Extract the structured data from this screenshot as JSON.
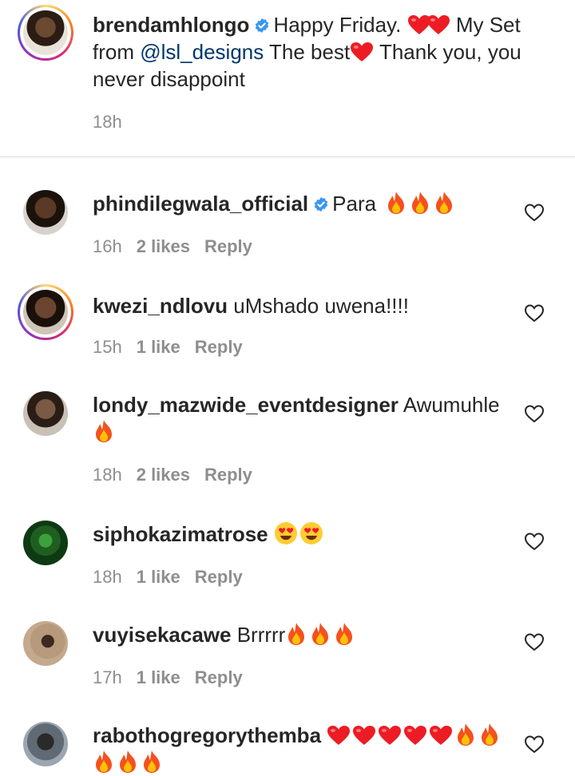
{
  "caption": {
    "username": "brendamhlongo",
    "text_part1": "Happy Friday.",
    "text_part2": "My Set from",
    "mention": "@lsl_designs",
    "text_part3": "The best",
    "text_part4": "Thank you, you never disappoint",
    "time": "18h"
  },
  "comments": [
    {
      "username": "phindilegwala_official",
      "text": "Para",
      "time": "16h",
      "likes": "2 likes",
      "reply": "Reply"
    },
    {
      "username": "kwezi_ndlovu",
      "text": "uMshado uwena!!!!",
      "time": "15h",
      "likes": "1 like",
      "reply": "Reply"
    },
    {
      "username": "londy_mazwide_eventdesigner",
      "text": "Awumuhle",
      "time": "18h",
      "likes": "2 likes",
      "reply": "Reply"
    },
    {
      "username": "siphokazimatrose",
      "text": "",
      "time": "18h",
      "likes": "1 like",
      "reply": "Reply"
    },
    {
      "username": "vuyisekacawe",
      "text": "Brrrrr",
      "time": "17h",
      "likes": "1 like",
      "reply": "Reply"
    },
    {
      "username": "rabothogregorythemba",
      "text": ""
    }
  ],
  "colors": {
    "text": "#262626",
    "secondary": "#8e8e8e",
    "mention": "#00376b",
    "verified": "#3897f0",
    "heart": "#ed1c24",
    "divider": "#dbdbdb"
  },
  "icons": [
    "verified-badge-icon",
    "heart-emoji-icon",
    "fire-emoji-icon",
    "heart-eyes-emoji-icon",
    "like-heart-outline-icon"
  ]
}
